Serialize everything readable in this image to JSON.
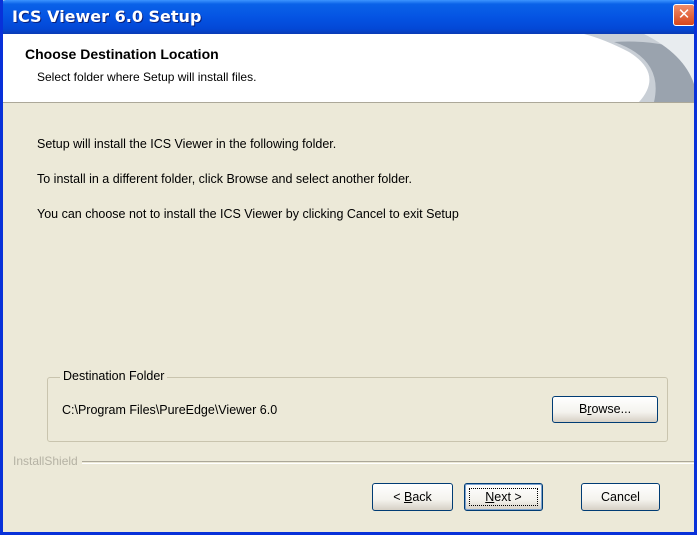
{
  "window": {
    "title": "ICS Viewer 6.0 Setup",
    "close_glyph": "✕"
  },
  "header": {
    "title": "Choose Destination Location",
    "subtitle": "Select folder where Setup will install files."
  },
  "body": {
    "line1": "Setup will install the ICS Viewer in the following folder.",
    "line2": "To install in a different folder, click Browse and select another folder.",
    "line3": "You can choose not to install the ICS Viewer by clicking Cancel to exit Setup"
  },
  "destination": {
    "group_label": "Destination Folder",
    "path": "C:\\Program Files\\PureEdge\\Viewer 6.0",
    "browse_prefix": "B",
    "browse_accel": "r",
    "browse_suffix": "owse..."
  },
  "footer": {
    "brand": "InstallShield",
    "back_prefix": "< ",
    "back_accel": "B",
    "back_suffix": "ack",
    "next_accel": "N",
    "next_suffix": "ext >",
    "cancel_label": "Cancel"
  },
  "icons": {
    "close": "close-icon",
    "header_art": "header-swoosh-graphic"
  },
  "colors": {
    "titlebar": "#0554e3",
    "dialog_bg": "#ece9d8",
    "close_button": "#d6461c"
  }
}
